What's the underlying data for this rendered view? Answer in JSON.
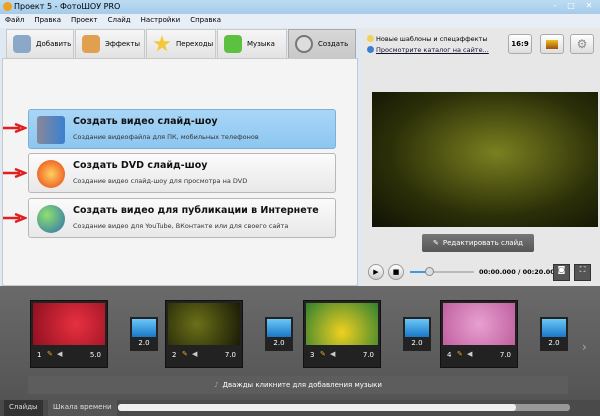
{
  "window": {
    "title": "Проект 5 - ФотоШОУ PRO",
    "controls": [
      "–",
      "□",
      "✕"
    ]
  },
  "menu": [
    "Файл",
    "Правка",
    "Проект",
    "Слайд",
    "Настройки",
    "Справка"
  ],
  "tabs": [
    {
      "label": "Добавить",
      "icon": "add-photo-icon"
    },
    {
      "label": "Эффекты",
      "icon": "palette-icon"
    },
    {
      "label": "Переходы",
      "icon": "star-icon"
    },
    {
      "label": "Музыка",
      "icon": "music-note-icon"
    },
    {
      "label": "Создать",
      "icon": "film-reel-icon",
      "active": true
    }
  ],
  "info": {
    "templates_link": "Новые шаблоны и спецэффекты",
    "catalog_link": "Просмотрите каталог на сайте...",
    "aspect_button": "16:9"
  },
  "create_options": [
    {
      "title": "Создать видео слайд-шоу",
      "subtitle": "Создание видеофайла для ПК, мобильных телефонов",
      "selected": true
    },
    {
      "title": "Создать DVD слайд-шоу",
      "subtitle": "Создание видео слайд-шоу для просмотра на DVD"
    },
    {
      "title": "Создать видео для публикации в Интернете",
      "subtitle": "Создание видео для YouTube, ВКонтакте или для своего сайта"
    }
  ],
  "preview": {
    "edit_button": "Редактировать слайд",
    "time": "00:00.000 / 00:20.000",
    "position_percent": 30
  },
  "slides": [
    {
      "num": "1",
      "duration": "5.0"
    },
    {
      "num": "2",
      "duration": "7.0"
    },
    {
      "num": "3",
      "duration": "7.0"
    },
    {
      "num": "4",
      "duration": "7.0"
    }
  ],
  "transitions": [
    "2.0",
    "2.0",
    "2.0",
    "2.0"
  ],
  "music_hint": "Дважды кликните для добавления музыки",
  "bottom_tabs": [
    "Слайды",
    "Шкала времени"
  ],
  "colors": {
    "selected_option": "#8cc6f0",
    "arrow": "#e02020",
    "timeline_bg": "#5a5a5a"
  }
}
